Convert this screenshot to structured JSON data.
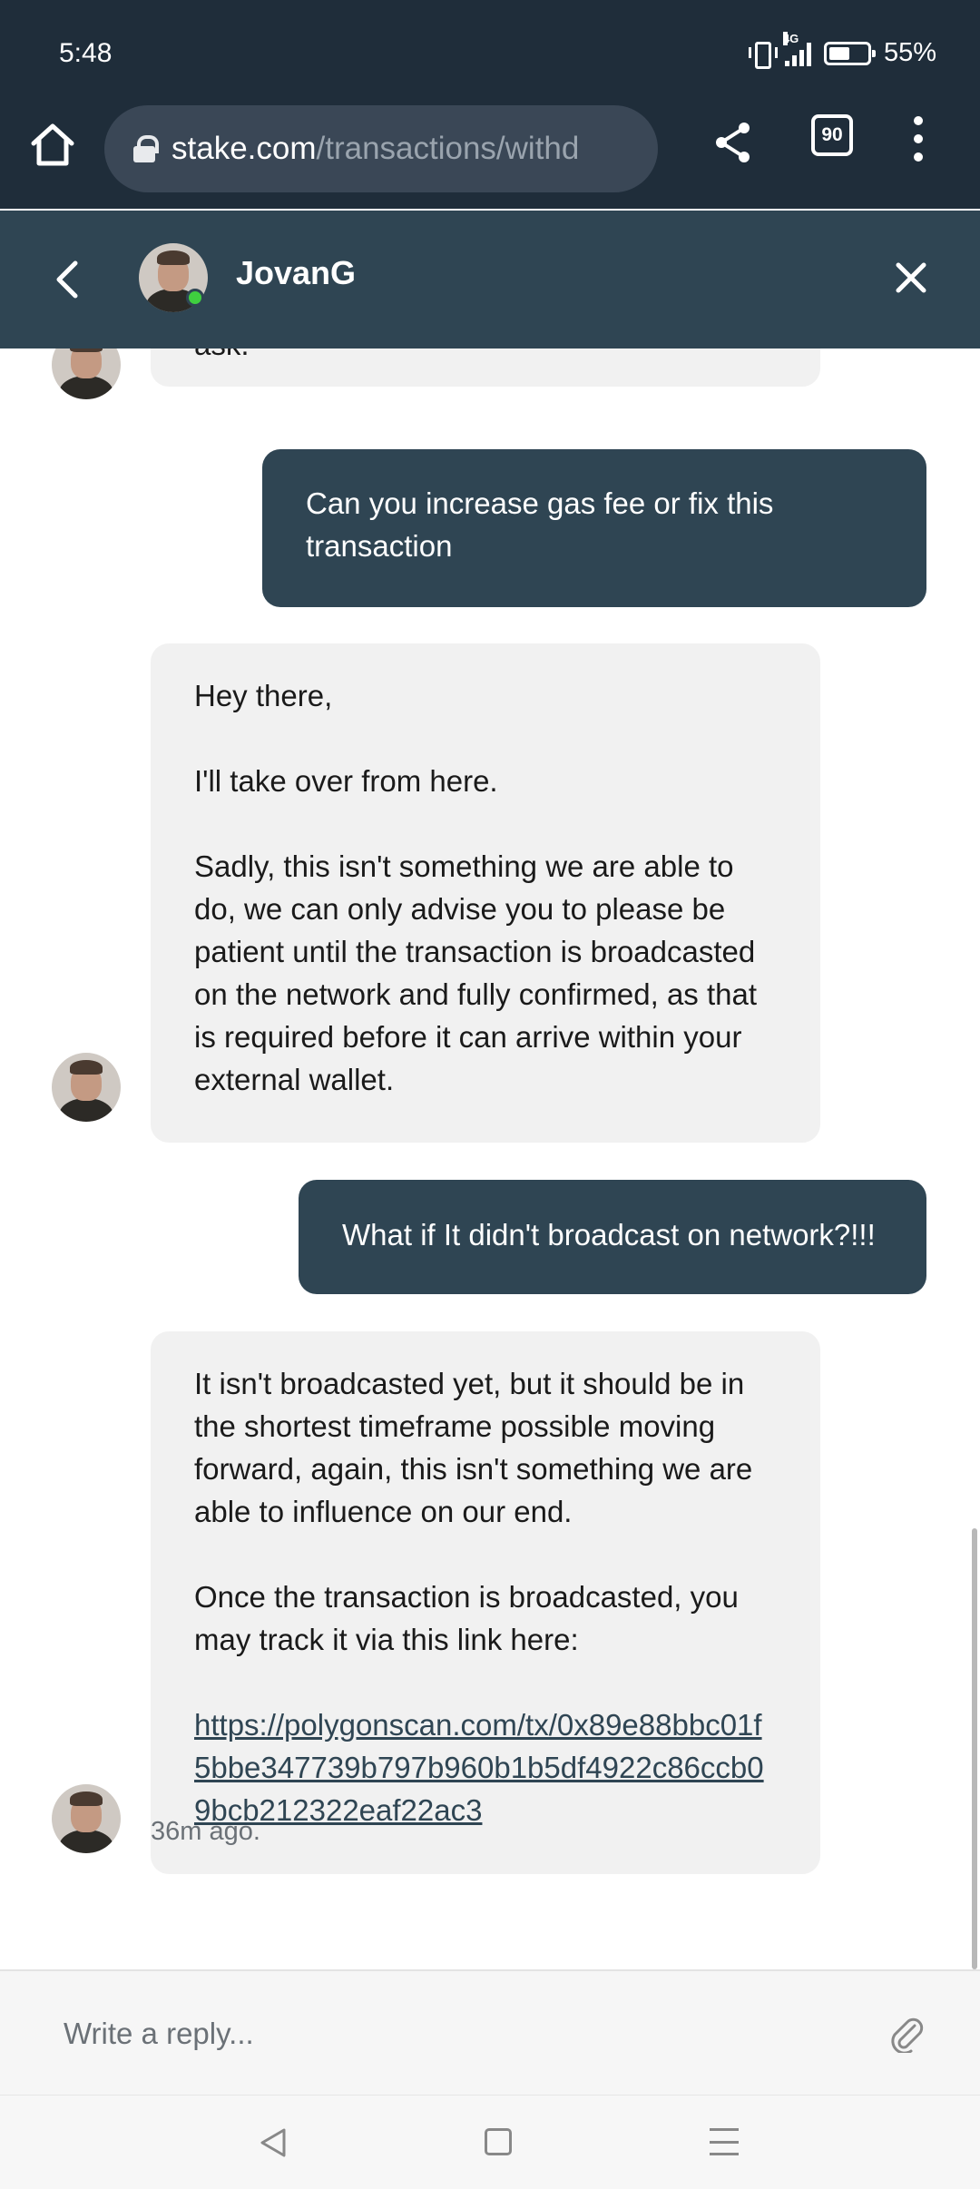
{
  "status_bar": {
    "time": "5:48",
    "network_tag": "4G",
    "battery": "55%"
  },
  "browser": {
    "url_domain": "stake.com",
    "url_path": "/transactions/withd",
    "tab_count": "90",
    "icons": [
      "home-icon",
      "lock-icon",
      "share-icon",
      "tabs-icon",
      "more-vert-icon"
    ]
  },
  "chat": {
    "header": {
      "name": "JovanG",
      "online": true
    },
    "messages": [
      {
        "from": "agent",
        "text": "ask."
      },
      {
        "from": "user",
        "text": "Can you increase gas fee or fix this transaction"
      },
      {
        "from": "agent",
        "text": "Hey there,\n\nI'll take over from here.\n\nSadly, this isn't something we are able to do, we can only advise you to please be patient until the transaction is broadcasted on the network and fully confirmed, as that is required before it can arrive within your external wallet."
      },
      {
        "from": "user",
        "text": "What if It didn't broadcast on network?!!!"
      },
      {
        "from": "agent",
        "text": "It isn't broadcasted yet, but it should be in the shortest timeframe possible moving forward, again, this isn't something we are able to influence on our end.\n\nOnce the transaction is broadcasted, you may track it via this link here:",
        "link": "https://polygonscan.com/tx/0x89e88bbc01f5bbe347739b797b960b1b5df4922c86ccb09bcb212322eaf22ac3"
      }
    ],
    "timestamp": "36m ago."
  },
  "reply": {
    "placeholder": "Write a reply..."
  },
  "colors": {
    "header": "#2f4553",
    "browser": "#1f2d3a",
    "agent_bubble": "#f1f1f1",
    "user_bubble": "#2f4553",
    "online": "#3fcf3f"
  }
}
